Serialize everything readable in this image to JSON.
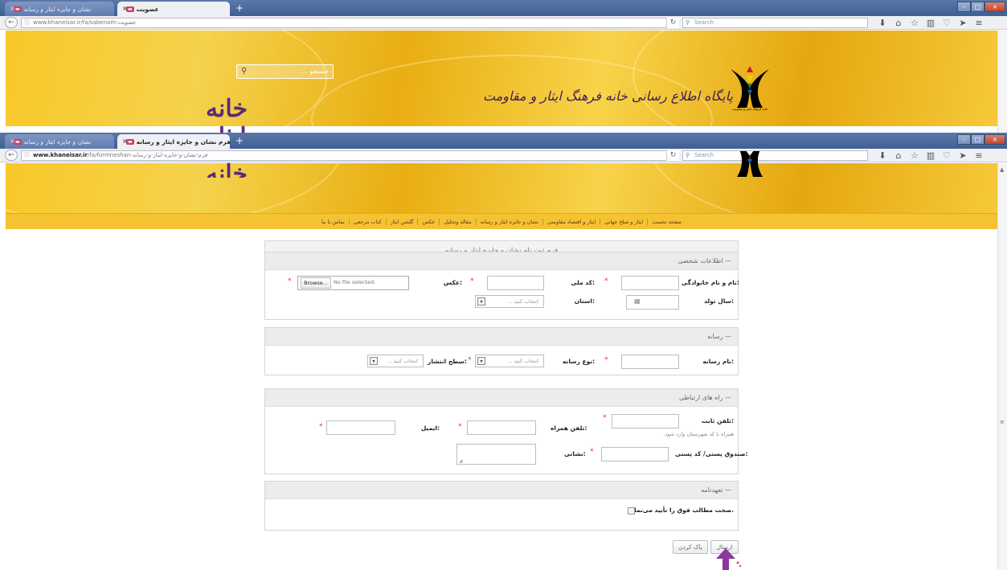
{
  "browser_top": {
    "tabs": [
      {
        "title": "نشان و جایزه ایثار و رسانه",
        "active": false
      },
      {
        "title": "عضویت",
        "active": true
      }
    ],
    "url_host": "www.khaneisar.ir",
    "url_path": "/fa/sabenam-عضویت",
    "search_placeholder": "Search",
    "new_tab": "+"
  },
  "browser_bottom": {
    "tabs": [
      {
        "title": "نشان و جایزه ایثار و رسانه",
        "active": false
      },
      {
        "title": "فرم نشان و جایزه ایثار و رسانه",
        "active": true
      }
    ],
    "url_host": "www.khaneisar.ir",
    "url_path": "/fa/formneshan-فرم-نشان-و-جایزه-ایثار-و-رسانه",
    "search_placeholder": "Search"
  },
  "site": {
    "search_placeholder": "جستجو ...",
    "logo_text": "خانه ایثار",
    "slogan": "پایگاه اطلاع رسانی خانه فرهنگ ایثار و مقاومت",
    "emblem_caption": "خانه فرهنگ ایثار و مقاومت"
  },
  "nav": [
    "صفحه نخست",
    "ایثار و صلح جهانی",
    "ایثار و اقتصاد مقاومتی",
    "نشان و جایزه ایثار و رسانه",
    "مقاله وتحلیل",
    "عکس",
    "گلشن ایثار",
    "کتاب مرجعی",
    "تماس با ما"
  ],
  "form": {
    "title": "فرم ثبت نام نشان و جایزه ایثار و رسانه",
    "personal": {
      "heading": "— اطلاعات شخصی",
      "name_label": "نام و نام خانوادگی:",
      "national_code_label": "کد ملی:",
      "photo_label": "عکس:",
      "browse_button": "Browse...",
      "no_file": "No file selected.",
      "birth_year_label": "سال تولد:",
      "province_label": "استان:",
      "province_select": "انتخاب کنید ..."
    },
    "media": {
      "heading": "— رسانه",
      "media_name_label": "نام رسانه:",
      "media_type_label": "نوع رسانه:",
      "media_type_select": "انتخاب کنید ...",
      "scope_label": "سطح انتشار:",
      "scope_select": "انتخاب کنید ..."
    },
    "contact": {
      "heading": "— راه های ارتباطی",
      "phone_label": "تلفن ثابت:",
      "phone_hint": "همراه با کد شهرستان وارد شود.",
      "mobile_label": "تلفن همراه:",
      "email_label": "ایمیل:",
      "postal_label": "صندوق پستی/ کد پستی:",
      "address_label": "نشانی:"
    },
    "pledge": {
      "heading": "— تعهدنامه",
      "checkbox_label": "صحت مطالب فوق را تأیید می‌نمایم."
    },
    "submit_button": "ارسال",
    "reset_button": "پاک کردن",
    "required_mark": "*"
  },
  "colors": {
    "accent": "#f5c232",
    "brand_purple": "#5d2a7a",
    "required": "#dd3333"
  },
  "icons": [
    "info-icon",
    "reload-icon",
    "search-icon",
    "download-icon",
    "home-icon",
    "bookmark-star-icon",
    "library-icon",
    "pocket-icon",
    "send-icon",
    "menu-icon",
    "calendar-icon",
    "dropdown-icon",
    "arrow-up-icon"
  ]
}
